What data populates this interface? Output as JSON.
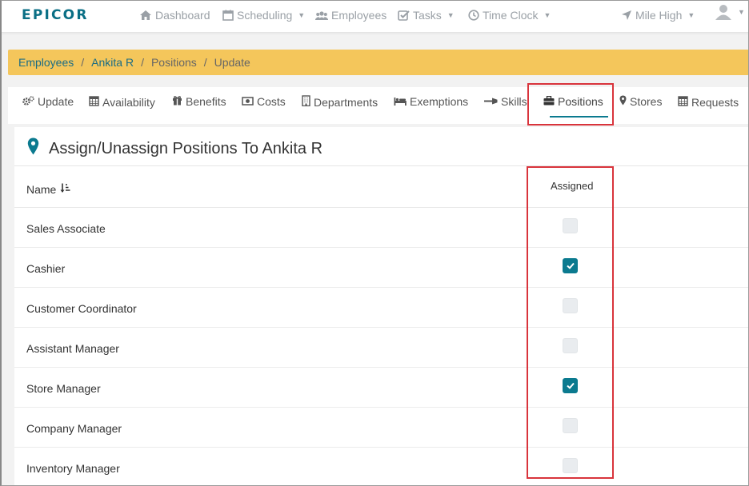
{
  "app": {
    "logo": "EPICOR"
  },
  "nav": {
    "items": [
      {
        "label": "Dashboard",
        "icon": "home-icon"
      },
      {
        "label": "Scheduling",
        "icon": "calendar-icon",
        "dropdown": true
      },
      {
        "label": "Employees",
        "icon": "users-icon"
      },
      {
        "label": "Tasks",
        "icon": "checkbox-icon",
        "dropdown": true
      },
      {
        "label": "Time Clock",
        "icon": "clock-icon",
        "dropdown": true
      }
    ],
    "location": {
      "label": "Mile High",
      "icon": "location-arrow-icon"
    },
    "user_icon": "user-icon"
  },
  "breadcrumb": {
    "items": [
      "Employees",
      "Ankita R",
      "Positions"
    ],
    "current": "Update"
  },
  "tabs": {
    "items": [
      {
        "label": "Update",
        "icon": "gears-icon"
      },
      {
        "label": "Availability",
        "icon": "calendar-icon"
      },
      {
        "label": "Benefits",
        "icon": "gift-icon"
      },
      {
        "label": "Costs",
        "icon": "money-icon"
      },
      {
        "label": "Departments",
        "icon": "building-icon"
      },
      {
        "label": "Exemptions",
        "icon": "bed-icon"
      },
      {
        "label": "Skills",
        "icon": "wrench-icon"
      },
      {
        "label": "Positions",
        "icon": "briefcase-icon",
        "active": true
      },
      {
        "label": "Stores",
        "icon": "map-marker-icon"
      },
      {
        "label": "Requests",
        "icon": "calendar-icon"
      }
    ]
  },
  "panel": {
    "title": "Assign/Unassign Positions To Ankita R",
    "title_icon": "map-marker-icon",
    "columns": {
      "name": "Name",
      "assigned": "Assigned"
    },
    "rows": [
      {
        "name": "Sales Associate",
        "assigned": false
      },
      {
        "name": "Cashier",
        "assigned": true
      },
      {
        "name": "Customer Coordinator",
        "assigned": false
      },
      {
        "name": "Assistant Manager",
        "assigned": false
      },
      {
        "name": "Store Manager",
        "assigned": true
      },
      {
        "name": "Company Manager",
        "assigned": false
      },
      {
        "name": "Inventory Manager",
        "assigned": false
      }
    ]
  },
  "colors": {
    "brand": "#0a6f85",
    "accent": "#0b7a8f",
    "breadcrumb_bg": "#f4c65b",
    "highlight": "#d9343c"
  }
}
